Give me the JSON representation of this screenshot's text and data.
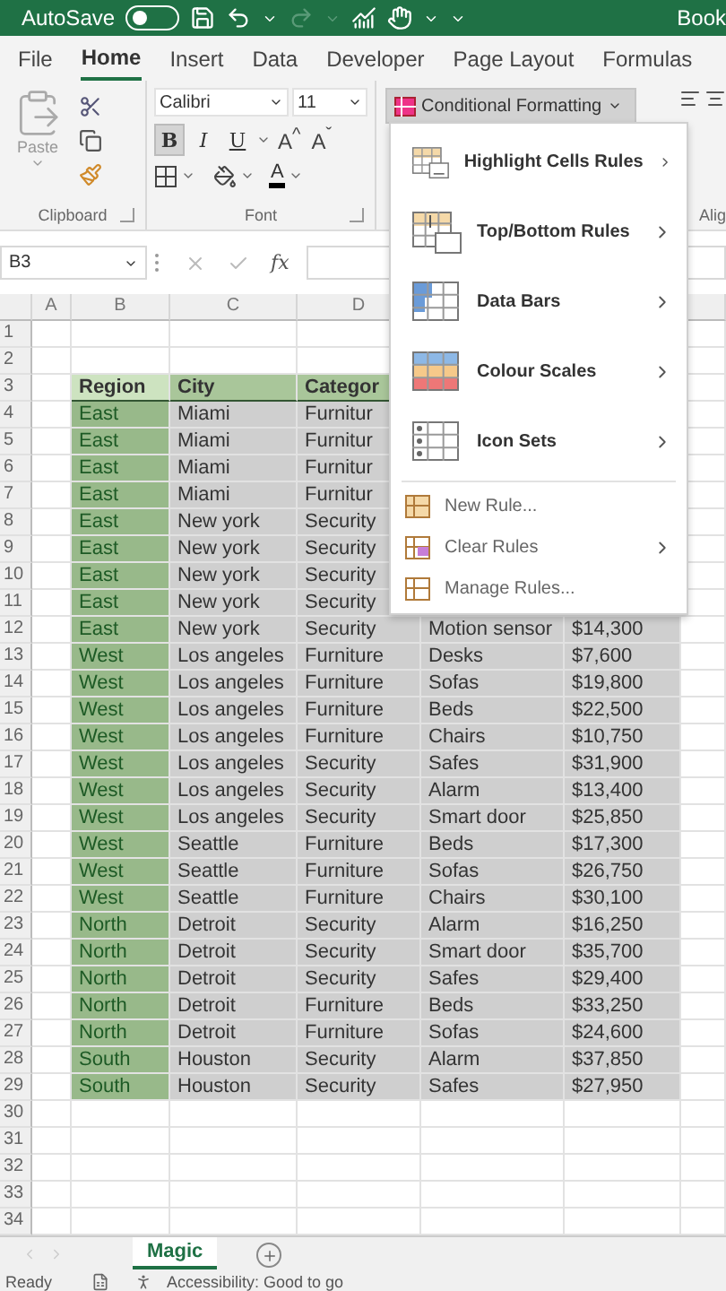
{
  "title_bar": {
    "autosave_label": "AutoSave",
    "autosave_on": false,
    "document_title": "Book"
  },
  "ribbon_tabs": [
    {
      "label": "File",
      "selected": false
    },
    {
      "label": "Home",
      "selected": true
    },
    {
      "label": "Insert",
      "selected": false
    },
    {
      "label": "Data",
      "selected": false
    },
    {
      "label": "Developer",
      "selected": false
    },
    {
      "label": "Page Layout",
      "selected": false
    },
    {
      "label": "Formulas",
      "selected": false
    }
  ],
  "ribbon": {
    "clipboard": {
      "paste_label": "Paste",
      "group_label": "Clipboard"
    },
    "font": {
      "font_name": "Calibri",
      "font_size": "11",
      "style_buttons": [
        {
          "label": "B",
          "selected": true
        },
        {
          "label": "I",
          "selected": false
        },
        {
          "label": "U",
          "selected": false
        }
      ],
      "size_buttons": [
        "A$^{^}$",
        "A$^{ˇ}$"
      ],
      "font_color_label": "A",
      "group_label": "Font"
    },
    "conditional_formatting": {
      "label": "Conditional Formatting",
      "pressed": true
    },
    "alignment": {
      "group_label": "Alig"
    }
  },
  "formula_bar": {
    "name_box": "B3",
    "function_label": "fx"
  },
  "column_headers": [
    "A",
    "B",
    "C",
    "D"
  ],
  "row_numbers": [
    "1",
    "2",
    "3",
    "4",
    "5",
    "6",
    "7",
    "8",
    "9",
    "10",
    "11",
    "12",
    "13",
    "14",
    "15",
    "16",
    "17",
    "18",
    "19",
    "20",
    "21",
    "22",
    "23",
    "24",
    "25",
    "26",
    "27",
    "28",
    "29",
    "30",
    "31",
    "32",
    "33",
    "34"
  ],
  "table": {
    "header": [
      "Region",
      "City",
      "Categor"
    ],
    "rows": [
      [
        "East",
        "Miami",
        "Furnitur"
      ],
      [
        "East",
        "Miami",
        "Furnitur"
      ],
      [
        "East",
        "Miami",
        "Furnitur"
      ],
      [
        "East",
        "Miami",
        "Furnitur"
      ],
      [
        "East",
        "New york",
        "Security"
      ],
      [
        "East",
        "New york",
        "Security"
      ],
      [
        "East",
        "New york",
        "Security"
      ],
      [
        "East",
        "New york",
        "Security"
      ],
      [
        "East",
        "New york",
        "Security",
        "Motion sensor",
        "$14,300"
      ],
      [
        "West",
        "Los angeles",
        "Furniture",
        "Desks",
        "$7,600"
      ],
      [
        "West",
        "Los angeles",
        "Furniture",
        "Sofas",
        "$19,800"
      ],
      [
        "West",
        "Los angeles",
        "Furniture",
        "Beds",
        "$22,500"
      ],
      [
        "West",
        "Los angeles",
        "Furniture",
        "Chairs",
        "$10,750"
      ],
      [
        "West",
        "Los angeles",
        "Security",
        "Safes",
        "$31,900"
      ],
      [
        "West",
        "Los angeles",
        "Security",
        "Alarm",
        "$13,400"
      ],
      [
        "West",
        "Los angeles",
        "Security",
        "Smart door",
        "$25,850"
      ],
      [
        "West",
        "Seattle",
        "Furniture",
        "Beds",
        "$17,300"
      ],
      [
        "West",
        "Seattle",
        "Furniture",
        "Sofas",
        "$26,750"
      ],
      [
        "West",
        "Seattle",
        "Furniture",
        "Chairs",
        "$30,100"
      ],
      [
        "North",
        "Detroit",
        "Security",
        "Alarm",
        "$16,250"
      ],
      [
        "North",
        "Detroit",
        "Security",
        "Smart door",
        "$35,700"
      ],
      [
        "North",
        "Detroit",
        "Security",
        "Safes",
        "$29,400"
      ],
      [
        "North",
        "Detroit",
        "Furniture",
        "Beds",
        "$33,250"
      ],
      [
        "North",
        "Detroit",
        "Furniture",
        "Sofas",
        "$24,600"
      ],
      [
        "South",
        "Houston",
        "Security",
        "Alarm",
        "$37,850"
      ],
      [
        "South",
        "Houston",
        "Security",
        "Safes",
        "$27,950"
      ]
    ]
  },
  "conditional_formatting_menu": [
    {
      "label": "Highlight Cells Rules",
      "kind": "large",
      "submenu": true
    },
    {
      "label": "Top/Bottom Rules",
      "kind": "large",
      "submenu": true
    },
    {
      "label": "Data Bars",
      "kind": "large",
      "submenu": true
    },
    {
      "label": "Colour Scales",
      "kind": "large",
      "submenu": true
    },
    {
      "label": "Icon Sets",
      "kind": "large",
      "submenu": true
    },
    {
      "label": "New Rule...",
      "kind": "small",
      "submenu": false
    },
    {
      "label": "Clear Rules",
      "kind": "small",
      "submenu": true
    },
    {
      "label": "Manage Rules...",
      "kind": "small",
      "submenu": false
    }
  ],
  "sheet_tabs": [
    {
      "label": "Magic",
      "selected": true
    }
  ],
  "status_bar": {
    "ready": "Ready",
    "accessibility": "Accessibility: Good to go"
  }
}
